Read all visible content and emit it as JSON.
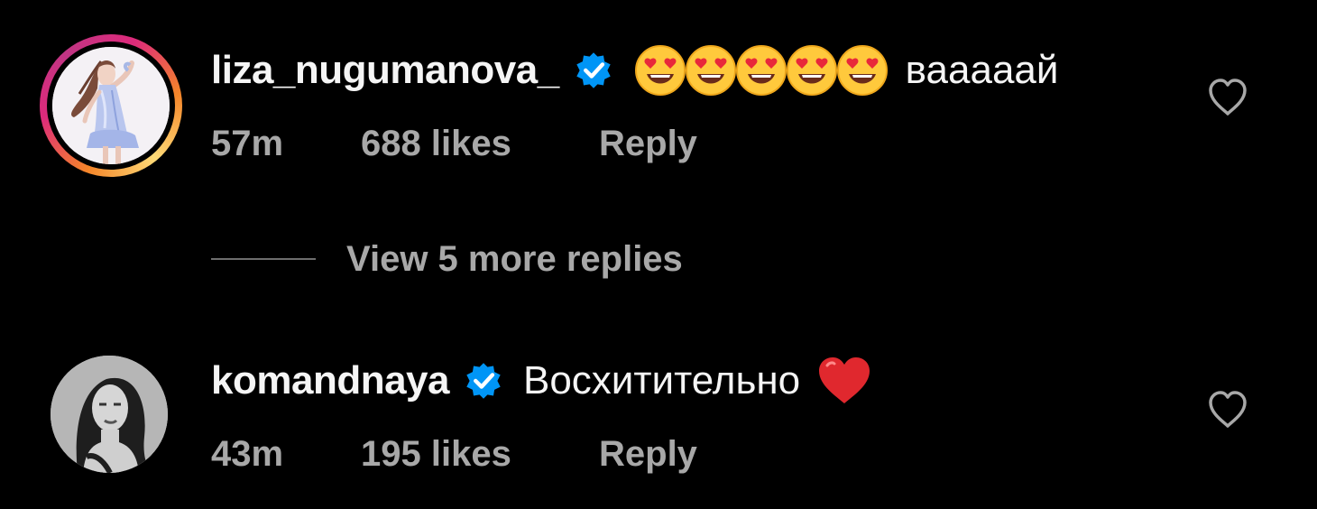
{
  "comments": [
    {
      "username": "liza_nugumanova_",
      "verified": true,
      "emoji": "smiling-face-with-heart-eyes",
      "emoji_count": 5,
      "text": "вааааай",
      "time": "57m",
      "likes": "688 likes",
      "reply_label": "Reply",
      "avatar_icon": "figure-skater-illustration-avatar",
      "has_story_ring": true
    },
    {
      "username": "komandnaya",
      "verified": true,
      "text": "Восхитительно",
      "trailing_emoji": "red-heart",
      "time": "43m",
      "likes": "195 likes",
      "reply_label": "Reply",
      "avatar_icon": "grayscale-portrait-avatar",
      "has_story_ring": false
    }
  ],
  "view_replies": {
    "label": "View 5 more replies"
  },
  "colors": {
    "background": "#000000",
    "username": "#f5f5f5",
    "meta": "#a8a8a8",
    "verified_badge": "#0095f6",
    "like_icon": "#a8a8a8",
    "heart_emoji": "#e0282e"
  }
}
